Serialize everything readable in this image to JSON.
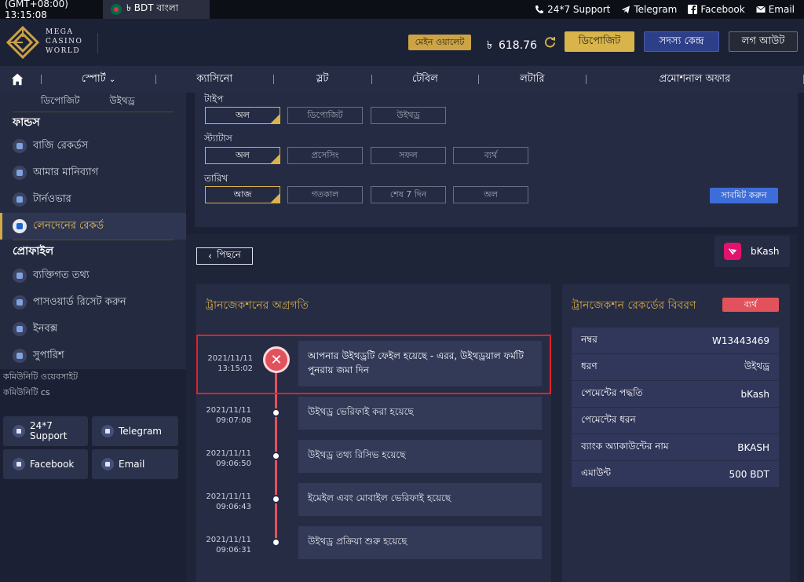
{
  "topbar": {
    "time": "(GMT+08:00) 13:15:08",
    "currency_lang": "৳ BDT বাংলা",
    "links": [
      "24*7 Support",
      "Telegram",
      "Facebook",
      "Email"
    ]
  },
  "header": {
    "logo_lines": [
      "MEGA",
      "CASINO",
      "WORLD"
    ],
    "wallet_label": "মেইন ওয়ালেট",
    "currency_symbol": "৳",
    "balance": "618.76",
    "deposit": "ডিপোজিট",
    "member_center": "সদস্য কেন্দ্র",
    "logout": "লগ আউট"
  },
  "nav": {
    "items": [
      "স্পোর্ট",
      "ক্যাসিনো",
      "স্লট",
      "টেবিল",
      "লটারি",
      "প্রমোশনাল অফার"
    ]
  },
  "sidebar": {
    "sublinks": [
      "ডিপোজিট",
      "উইথড্র"
    ],
    "funds_heading": "ফান্ডস",
    "funds_items": [
      "বাজি রেকর্ডস",
      "আমার মানিব্যাগ",
      "টার্নওভার",
      "লেনদেনের রেকর্ড"
    ],
    "profile_heading": "প্রোফাইল",
    "profile_items": [
      "ব্যক্তিগত তথ্য",
      "পাসওয়ার্ড রিসেট করুন",
      "ইনবক্স",
      "সুপারিশ"
    ],
    "community_site": "কমিউনিটি ওয়েবসাইট",
    "community_cs": "কমিউনিটি cs",
    "community_buttons": [
      "24*7 Support",
      "Telegram",
      "Facebook",
      "Email"
    ]
  },
  "filter": {
    "type_label": "টাইপ",
    "type_options": [
      "অল",
      "ডিপোজিট",
      "উইথড্র"
    ],
    "status_label": "স্ট্যাটাস",
    "status_options": [
      "অল",
      "প্রসেসিং",
      "সফল",
      "ব্যর্থ"
    ],
    "date_label": "তারিখ",
    "date_options": [
      "আজ",
      "গতকাল",
      "শেষ 7 দিন",
      "অল"
    ],
    "submit": "সাবমিট করুন"
  },
  "main": {
    "back": "পিছনে",
    "payment_brand": "bKash",
    "progress_title": "ট্রানজেকশনের অগ্রগতি",
    "timeline": [
      {
        "date": "2021/11/11",
        "time": "13:15:02",
        "text": "আপনার উইথড্রটি ফেইল হয়েছে - এরর, উইথড্রয়াল ফর্মটি পুনরায় জমা দিন",
        "status": "error"
      },
      {
        "date": "2021/11/11",
        "time": "09:07:08",
        "text": "উইথড্র ভেরিফাই করা হয়েছে",
        "status": "done"
      },
      {
        "date": "2021/11/11",
        "time": "09:06:50",
        "text": "উইথড্র তথ্য রিসিভ হয়েছে",
        "status": "done"
      },
      {
        "date": "2021/11/11",
        "time": "09:06:43",
        "text": "ইমেইল এবং মোবাইল ভেরিফাই হয়েছে",
        "status": "done"
      },
      {
        "date": "2021/11/11",
        "time": "09:06:31",
        "text": "উইথড্র প্রক্রিয়া শুরু হয়েছে",
        "status": "done"
      }
    ],
    "details_title": "ট্রানজেকশন রেকর্ডের বিবরণ",
    "status_badge": "ব্যর্থ",
    "details": [
      {
        "label": "নম্বর",
        "value": "W13443469"
      },
      {
        "label": "ধরণ",
        "value": "উইথড্র"
      },
      {
        "label": "পেমেন্টের পদ্ধতি",
        "value": "bKash"
      },
      {
        "label": "পেমেন্টের ধরন",
        "value": ""
      },
      {
        "label": "ব্যাংক অ্যাকাউন্টের নাম",
        "value": "BKASH"
      },
      {
        "label": "এমাউন্ট",
        "value": "500 BDT"
      }
    ]
  },
  "colors": {
    "accent_gold": "#d9b44a",
    "error_red": "#e2525c",
    "highlight_border": "#e0212b",
    "primary_blue": "#2e3f89"
  }
}
